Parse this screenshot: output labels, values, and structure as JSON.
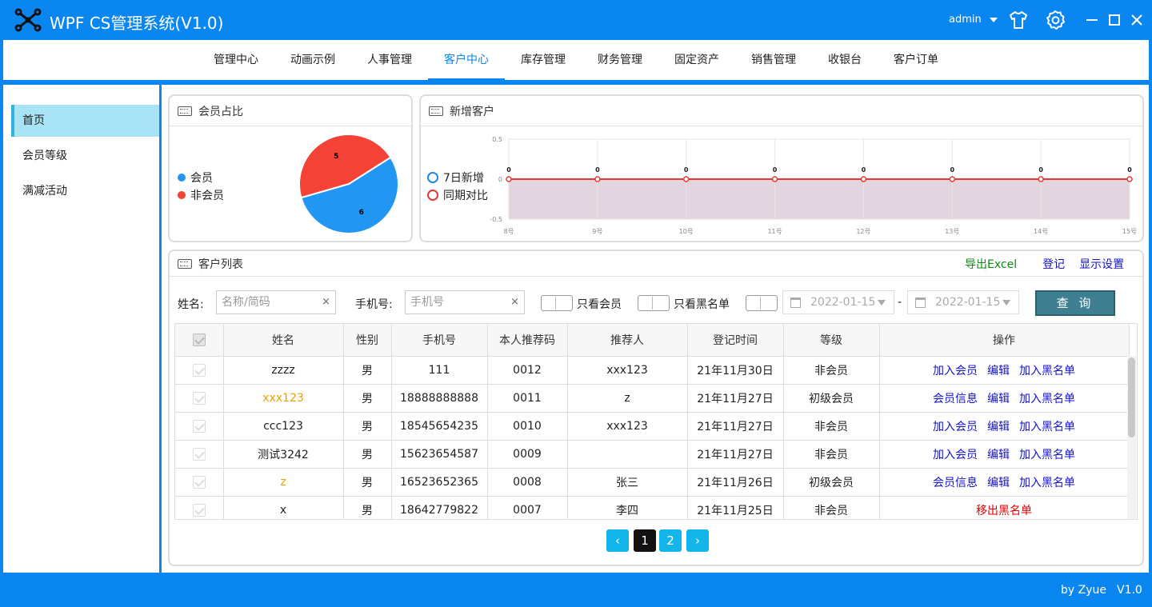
{
  "app": {
    "title": "WPF CS管理系统(V1.0)",
    "user": "admin"
  },
  "nav": {
    "items": [
      "管理中心",
      "动画示例",
      "人事管理",
      "客户中心",
      "库存管理",
      "财务管理",
      "固定资产",
      "销售管理",
      "收银台",
      "客户订单"
    ],
    "active": "客户中心"
  },
  "sidebar": {
    "items": [
      "首页",
      "会员等级",
      "满减活动"
    ],
    "active": "首页"
  },
  "member_card": {
    "title": "会员占比",
    "legend": [
      "会员",
      "非会员"
    ],
    "colors": [
      "#2196f3",
      "#f44336"
    ]
  },
  "new_customers_card": {
    "title": "新增客户",
    "legend": [
      "7日新增",
      "同期对比"
    ],
    "colors": [
      "#1e88e5",
      "#e53935"
    ]
  },
  "chart_data": [
    {
      "type": "pie",
      "title": "",
      "labels": [
        "会员",
        "非会员"
      ],
      "values": [
        6,
        5
      ],
      "data_labels": [
        "6",
        "5"
      ]
    },
    {
      "type": "area",
      "title": "",
      "x": [
        "8号",
        "9号",
        "10号",
        "11号",
        "12号",
        "13号",
        "14号",
        "15号"
      ],
      "series": [
        {
          "name": "同期对比",
          "values": [
            0,
            0,
            0,
            0,
            0,
            0,
            0,
            0
          ]
        }
      ],
      "ylim": [
        -0.5,
        0.5
      ],
      "yticks": [
        "0.5",
        "0",
        "-0.5"
      ],
      "grid": true
    }
  ],
  "customer_list": {
    "title": "客户列表",
    "export_label": "导出Excel",
    "register_label": "登记",
    "display_settings_label": "显示设置",
    "filters": {
      "name_label": "姓名:",
      "name_placeholder": "名称/简码",
      "phone_label": "手机号:",
      "phone_placeholder": "手机号",
      "member_only_label": "只看会员",
      "blacklist_only_label": "只看黑名单",
      "date_start": "2022-01-15",
      "date_sep": "-",
      "date_end": "2022-01-15",
      "query_label": "查 询",
      "clear": "×"
    },
    "columns": [
      "姓名",
      "性别",
      "手机号",
      "本人推荐码",
      "推荐人",
      "登记时间",
      "等级",
      "操作"
    ],
    "rows": [
      {
        "name": "zzzz",
        "gender": "男",
        "phone": "111",
        "code": "0012",
        "referrer": "xxx123",
        "time": "21年11月30日",
        "level": "非会员",
        "highlight": false,
        "actions": [
          "加入会员",
          "编辑",
          "加入黑名单"
        ]
      },
      {
        "name": "xxx123",
        "gender": "男",
        "phone": "18888888888",
        "code": "0011",
        "referrer": "z",
        "time": "21年11月27日",
        "level": "初级会员",
        "highlight": true,
        "actions": [
          "会员信息",
          "编辑",
          "加入黑名单"
        ]
      },
      {
        "name": "ccc123",
        "gender": "男",
        "phone": "18545654235",
        "code": "0010",
        "referrer": "xxx123",
        "time": "21年11月27日",
        "level": "非会员",
        "highlight": false,
        "actions": [
          "加入会员",
          "编辑",
          "加入黑名单"
        ]
      },
      {
        "name": "测试3242",
        "gender": "男",
        "phone": "15623654587",
        "code": "0009",
        "referrer": "",
        "time": "21年11月27日",
        "level": "非会员",
        "highlight": false,
        "actions": [
          "加入会员",
          "编辑",
          "加入黑名单"
        ]
      },
      {
        "name": "z",
        "gender": "男",
        "phone": "16523652365",
        "code": "0008",
        "referrer": "张三",
        "time": "21年11月26日",
        "level": "初级会员",
        "highlight": true,
        "actions": [
          "会员信息",
          "编辑",
          "加入黑名单"
        ]
      },
      {
        "name": "x",
        "gender": "男",
        "phone": "18642779822",
        "code": "0007",
        "referrer": "李四",
        "time": "21年11月25日",
        "level": "非会员",
        "highlight": false,
        "actions": [
          "移出黑名单"
        ]
      }
    ],
    "pagination": {
      "prev": "‹",
      "pages": [
        "1",
        "2"
      ],
      "current": "1",
      "next": "›"
    }
  },
  "footer": {
    "author": "by Zyue",
    "version": "V1.0"
  },
  "colors": {
    "brand": "#0a86f0",
    "link_blue": "#1414c8",
    "link_red": "#e00000",
    "highlight_name": "#f0a000",
    "export_green": "#108a10",
    "area_fill": "#e2d5e0"
  }
}
